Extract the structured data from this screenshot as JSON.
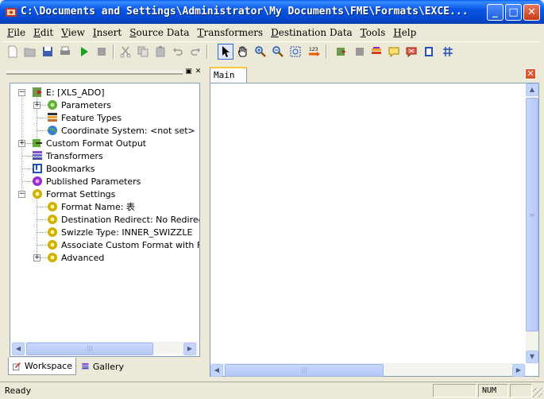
{
  "window": {
    "title": "C:\\Documents and Settings\\Administrator\\My Documents\\FME\\Formats\\EXCE...",
    "buttons": [
      "minimize",
      "maximize",
      "close"
    ]
  },
  "menu": [
    "File",
    "Edit",
    "View",
    "Insert",
    "Source Data",
    "Transformers",
    "Destination Data",
    "Tools",
    "Help"
  ],
  "toolbar_icons": [
    "new-icon",
    "open-icon",
    "save-icon",
    "print-icon",
    "run-icon",
    "stop-icon",
    "cut-icon",
    "copy-icon",
    "paste-icon",
    "undo-icon",
    "redo-icon",
    "select-icon",
    "pan-icon",
    "zoom-in-icon",
    "zoom-out-icon",
    "zoom-extents-icon",
    "feature-count-icon",
    "add-reader-icon",
    "add-writer-icon",
    "add-transformer-icon",
    "annotation-icon",
    "remove-icon",
    "bookmark-icon",
    "grid-icon"
  ],
  "tree": {
    "root": "E: [XLS_ADO]",
    "parameters": "Parameters",
    "feature_types": "Feature Types",
    "coordinate_system": "Coordinate System: <not set>",
    "custom_format_output": "Custom Format Output",
    "transformers": "Transformers",
    "bookmarks": "Bookmarks",
    "published_parameters": "Published Parameters",
    "format_settings": "Format Settings",
    "format_name": "Format Name: 表",
    "destination_redirect": "Destination Redirect: No Redirect",
    "swizzle_type": "Swizzle Type: INNER_SWIZZLE",
    "associate_custom_format": "Associate Custom Format with File",
    "advanced": "Advanced"
  },
  "bottom_tabs": {
    "workspace": "Workspace",
    "gallery": "Gallery"
  },
  "canvas_tab": "Main",
  "status": {
    "text": "Ready",
    "num": "NUM"
  }
}
